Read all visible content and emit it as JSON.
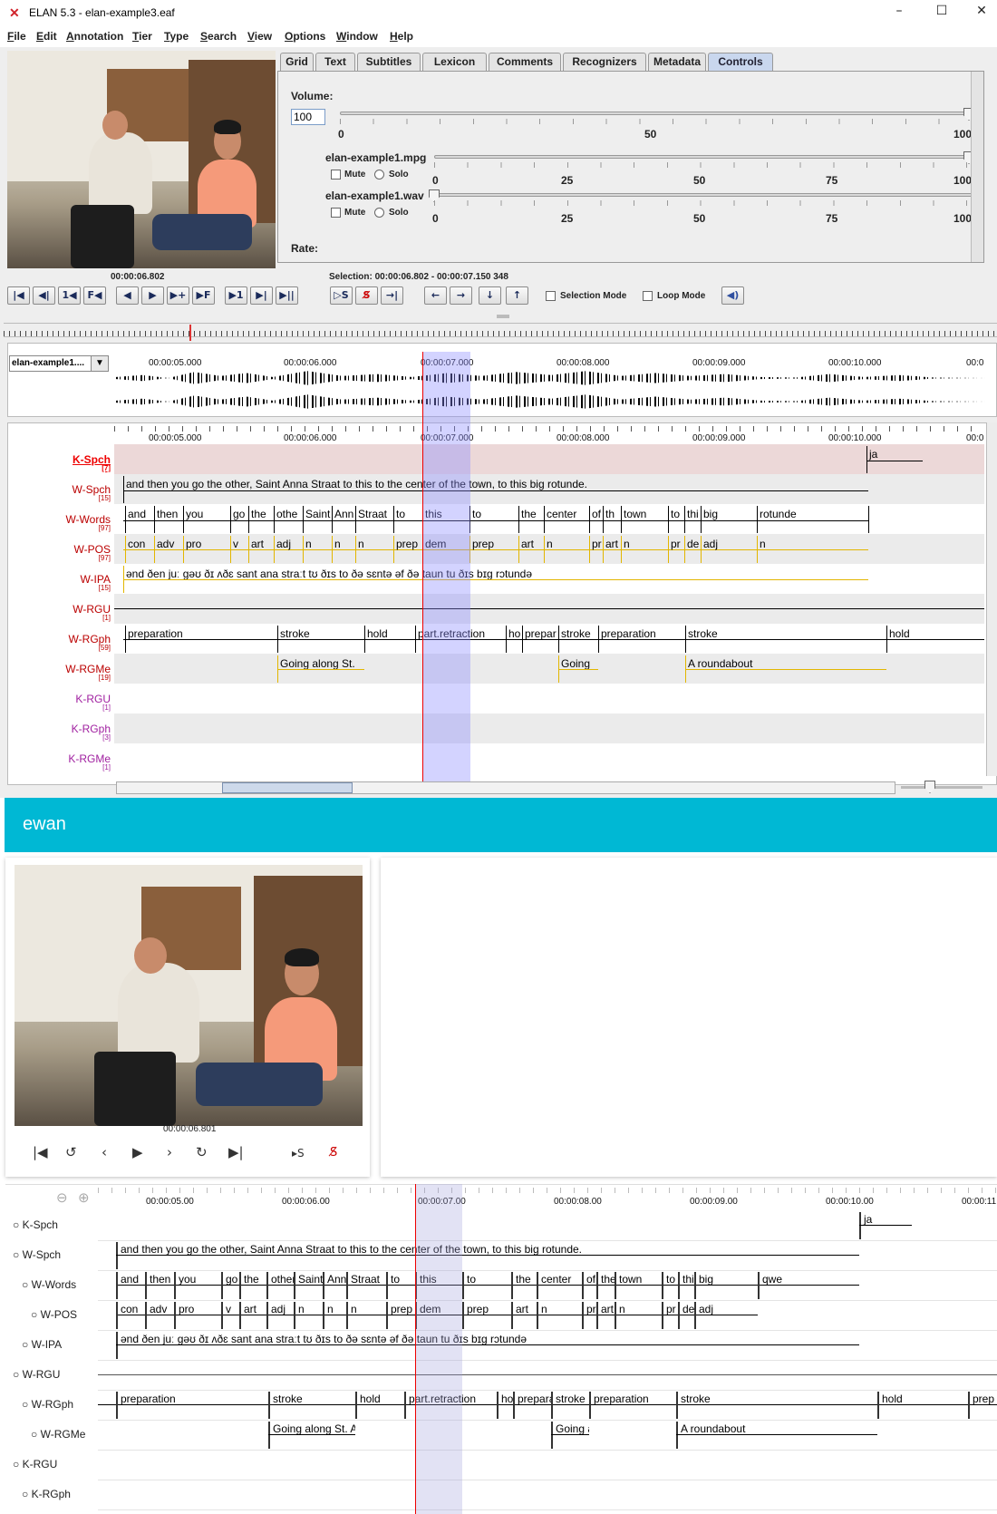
{
  "window": {
    "title": "ELAN 5.3 - elan-example3.eaf",
    "minimize": "–",
    "maximize": "☐",
    "close": "✕"
  },
  "menu": [
    "File",
    "Edit",
    "Annotation",
    "Tier",
    "Type",
    "Search",
    "View",
    "Options",
    "Window",
    "Help"
  ],
  "tabs": [
    "Grid",
    "Text",
    "Subtitles",
    "Lexicon",
    "Comments",
    "Recognizers",
    "Metadata",
    "Controls"
  ],
  "controls": {
    "volume_label": "Volume:",
    "volume_value": "100",
    "volume_ticks": [
      "0",
      "50",
      "100"
    ],
    "file1": "elan-example1.mpg",
    "file2": "elan-example1.wav",
    "file_ticks": [
      "0",
      "25",
      "50",
      "75",
      "100"
    ],
    "mute": "Mute",
    "solo": "Solo",
    "rate_label": "Rate:"
  },
  "player": {
    "time": "00:00:06.802",
    "selection": "Selection: 00:00:06.802 - 00:00:07.150  348",
    "selection_mode": "Selection Mode",
    "loop_mode": "Loop Mode"
  },
  "waveform": {
    "track_select": "elan-example1....",
    "ruler": [
      "00:00:05.000",
      "00:00:06.000",
      "00:00:07.000",
      "00:00:08.000",
      "00:00:09.000",
      "00:00:10.000",
      "00:0"
    ]
  },
  "elan_tiers": [
    {
      "name": "K-Spch",
      "count": "[7]"
    },
    {
      "name": "W-Spch",
      "count": "[15]"
    },
    {
      "name": "W-Words",
      "count": "[97]"
    },
    {
      "name": "W-POS",
      "count": "[97]"
    },
    {
      "name": "W-IPA",
      "count": "[15]"
    },
    {
      "name": "W-RGU",
      "count": "[1]"
    },
    {
      "name": "W-RGph",
      "count": "[59]"
    },
    {
      "name": "W-RGMe",
      "count": "[19]"
    },
    {
      "name": "K-RGU",
      "count": "[1]"
    },
    {
      "name": "K-RGph",
      "count": "[3]"
    },
    {
      "name": "K-RGMe",
      "count": "[1]"
    }
  ],
  "annotations": {
    "kspch": "ja",
    "wspch": "and then you go the other, Saint Anna Straat to this to the center of the town, to this big rotunde.",
    "words": [
      "and",
      "then",
      "you",
      "go",
      "the",
      "othe",
      "Saint",
      "Ann",
      "Straat",
      "to",
      "this",
      "to",
      "the",
      "center",
      "of",
      "th",
      "town",
      "to",
      "thi",
      "big",
      "rotunde"
    ],
    "pos": [
      "con",
      "adv",
      "pro",
      "v",
      "art",
      "adj",
      "n",
      "n",
      "n",
      "prep",
      "dem",
      "prep",
      "art",
      "n",
      "pr",
      "art",
      "n",
      "pr",
      "de",
      "adj",
      "n"
    ],
    "ipa": "ənd ðen juː ɡəʊ ðɪ ʌðɛ sant ana straːt tʊ ðɪs to ðə sɛntə əf ðə taun tu ðɪs bɪɡ rɔtundə",
    "rgph": [
      "preparation",
      "stroke",
      "hold",
      "part.retraction",
      "ho",
      "prepar",
      "stroke",
      "preparation",
      "stroke",
      "hold"
    ],
    "rgme": [
      "Going along St.",
      "Going",
      "A roundabout"
    ]
  },
  "ewan": {
    "brand": "ewan",
    "time": "00:00:06.801",
    "ruler": [
      "00:00:05.00",
      "00:00:06.00",
      "00:00:07.00",
      "00:00:08.00",
      "00:00:09.00",
      "00:00:10.00",
      "00:00:11"
    ],
    "tiers": [
      "K-Spch",
      "W-Spch",
      "W-Words",
      "W-POS",
      "W-IPA",
      "W-RGU",
      "W-RGph",
      "W-RGMe",
      "K-RGU",
      "K-RGph"
    ],
    "kspch": "ja",
    "wspch": "and then you go the other, Saint Anna Straat to this to the center of the town, to this big rotunde.",
    "words": [
      "and",
      "then",
      "you",
      "go",
      "the",
      "other",
      "Saint",
      "Ann",
      "Straat",
      "to",
      "this",
      "to",
      "the",
      "center",
      "of",
      "the",
      "town",
      "to",
      "this",
      "big",
      "qwe"
    ],
    "pos": [
      "con",
      "adv",
      "pro",
      "v",
      "art",
      "adj",
      "n",
      "n",
      "n",
      "prep",
      "dem",
      "prep",
      "art",
      "n",
      "pr",
      "art",
      "n",
      "pr",
      "dem",
      "adj"
    ],
    "ipa": "ənd ðen juː ɡəʊ ðɪ ʌðɛ sant ana straːt tʊ ðɪs to ðə sɛntə əf ðə taun tu ðɪs bɪɡ rɔtundə",
    "rgph": [
      "preparation",
      "stroke",
      "hold",
      "part.retraction",
      "ho",
      "prepara",
      "stroke",
      "preparation",
      "stroke",
      "hold",
      "prep"
    ],
    "rgme": [
      "Going along St. A",
      "Going a",
      "A roundabout"
    ]
  }
}
